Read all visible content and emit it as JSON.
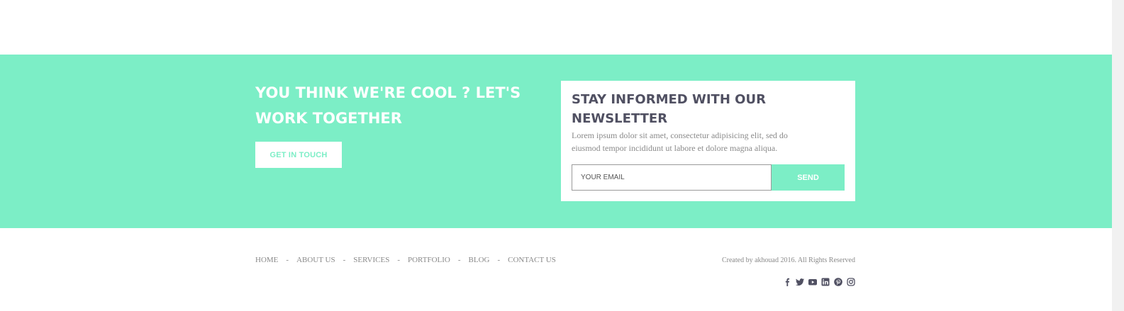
{
  "cta": {
    "title": "YOU THINK WE'RE COOL ? LET'S WORK TOGETHER",
    "button_label": "GET IN TOUCH"
  },
  "newsletter": {
    "title": "STAY INFORMED WITH OUR NEWSLETTER",
    "description": "Lorem ipsum dolor sit amet, consectetur adipisicing elit, sed do eiusmod tempor incididunt ut labore et dolore magna aliqua.",
    "email_placeholder": "YOUR EMAIL",
    "email_value": "",
    "send_label": "SEND"
  },
  "footer": {
    "nav": [
      {
        "label": "HOME"
      },
      {
        "label": "ABOUT US"
      },
      {
        "label": "SERVICES"
      },
      {
        "label": "PORTFOLIO"
      },
      {
        "label": "BLOG"
      },
      {
        "label": "CONTACT US"
      }
    ],
    "separator": "-",
    "copyright": "Created by akhouad 2016. All Rights Reserved",
    "social": [
      "facebook-icon",
      "twitter-icon",
      "youtube-icon",
      "linkedin-icon",
      "pinterest-icon",
      "instagram-icon"
    ]
  },
  "colors": {
    "accent": "#7ceec6",
    "heading": "#505062",
    "muted": "#8a8a8a"
  }
}
